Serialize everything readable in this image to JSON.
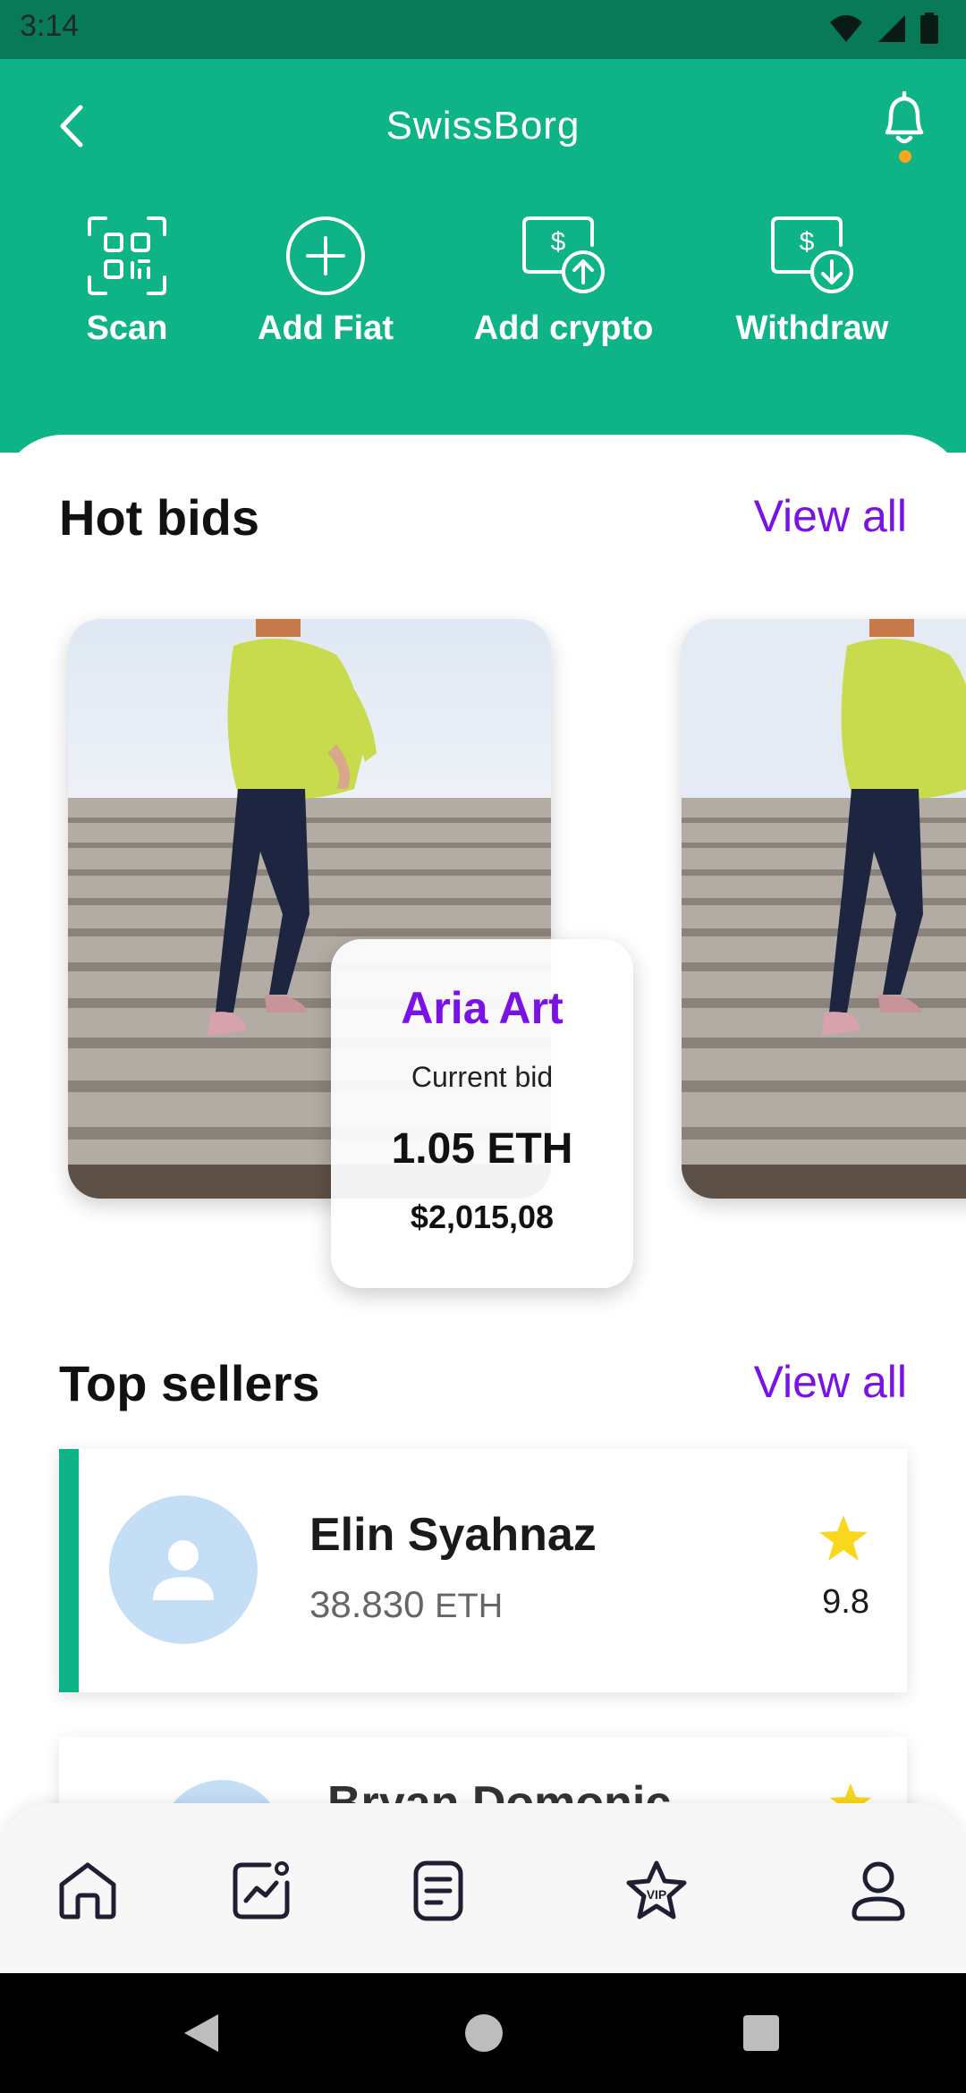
{
  "status_bar": {
    "time": "3:14"
  },
  "header": {
    "title": "SwissBorg",
    "actions": [
      {
        "label": "Scan",
        "icon": "qr-scan-icon"
      },
      {
        "label": "Add Fiat",
        "icon": "plus-circle-icon"
      },
      {
        "label": "Add crypto",
        "icon": "dollar-upload-icon"
      },
      {
        "label": "Withdraw",
        "icon": "dollar-download-icon"
      }
    ]
  },
  "hot_bids": {
    "title": "Hot bids",
    "view_all": "View all",
    "featured": {
      "artist": "Aria Art",
      "label": "Current bid",
      "eth": "1.05 ETH",
      "usd": "$2,015,08"
    }
  },
  "top_sellers": {
    "title": "Top sellers",
    "view_all": "View all",
    "items": [
      {
        "name": "Elin Syahnaz",
        "amount": "38.830",
        "unit": "ETH",
        "rating": "9.8"
      },
      {
        "name": "Bryan Domonic"
      }
    ]
  },
  "bottom_nav": [
    {
      "icon": "home-icon"
    },
    {
      "icon": "chart-icon"
    },
    {
      "icon": "document-icon"
    },
    {
      "icon": "vip-star-icon"
    },
    {
      "icon": "profile-icon"
    }
  ],
  "colors": {
    "primary": "#0eb487",
    "accent": "#7a12e6",
    "star": "#f9d71c"
  }
}
